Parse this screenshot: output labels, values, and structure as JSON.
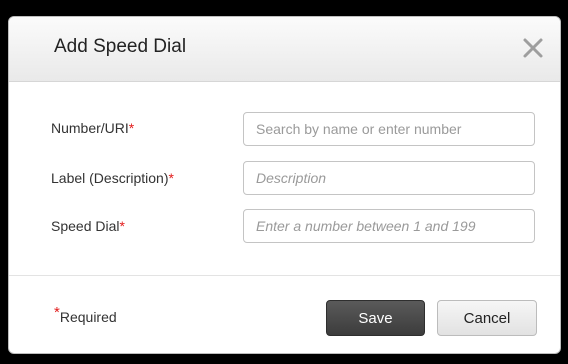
{
  "dialog": {
    "title": "Add Speed Dial",
    "close_icon": "close-icon"
  },
  "form": {
    "number": {
      "label": "Number/URI",
      "placeholder": "Search by name or enter number",
      "value": ""
    },
    "description": {
      "label": "Label (Description)",
      "placeholder": "Description",
      "value": ""
    },
    "speed_dial": {
      "label": "Speed Dial",
      "placeholder": "Enter a number between 1 and 199",
      "value": ""
    },
    "required_mark": "*"
  },
  "footer": {
    "required_mark": "*",
    "required_text": "Required",
    "save_label": "Save",
    "cancel_label": "Cancel"
  },
  "colors": {
    "required": "#e21b1b",
    "save_button": "#4a4a4a",
    "backdrop": "#000000"
  }
}
